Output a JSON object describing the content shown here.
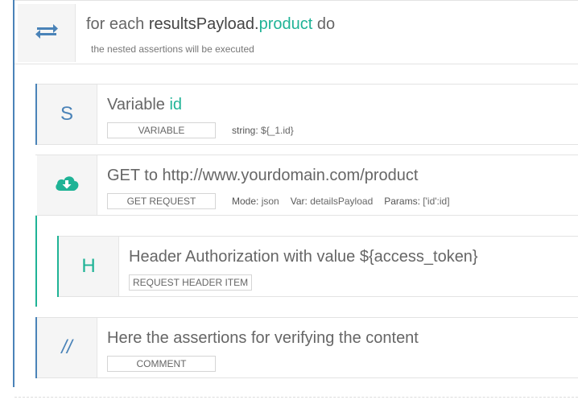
{
  "foreach": {
    "icon": "repeat-icon",
    "prefix": "for each ",
    "collection": "resultsPayload.",
    "field": "product",
    "suffix": " do",
    "subtitle": "the nested assertions will be executed"
  },
  "steps": [
    {
      "icon_letter": "S",
      "title_prefix": "Variable ",
      "title_accent": "id",
      "tag": "VARIABLE",
      "params": [
        {
          "key": "string:",
          "value": "${_1.id}"
        }
      ]
    },
    {
      "icon": "cloud-download-icon",
      "title": "GET to http://www.yourdomain.com/product",
      "tag": "GET REQUEST",
      "params": [
        {
          "key": "Mode:",
          "value": "json"
        },
        {
          "key": "Var:",
          "value": "detailsPayload"
        },
        {
          "key": "Params:",
          "value": "['id':id]"
        }
      ]
    },
    {
      "icon_letter": "H",
      "title": "Header Authorization with value ${access_token}",
      "tag": "REQUEST HEADER ITEM"
    },
    {
      "icon_letter": "//",
      "title": "Here the assertions for verifying the content",
      "tag": "COMMENT"
    }
  ],
  "colors": {
    "blue_bar": "#4a83b8",
    "green_bar": "#1fb396",
    "accent_text": "#1fb396",
    "icon_blue": "#4a83b8"
  }
}
